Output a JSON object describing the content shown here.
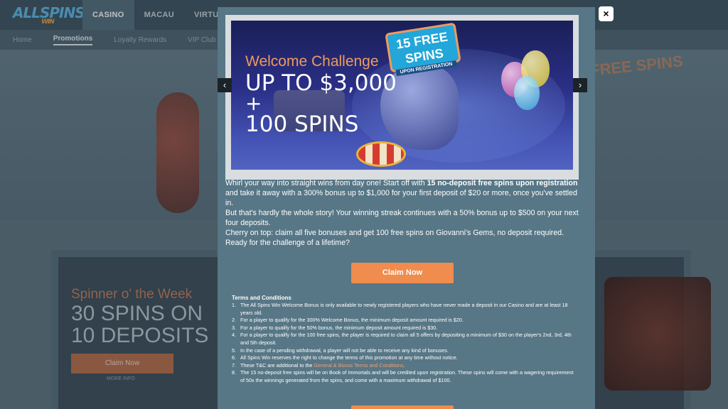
{
  "site": {
    "logo": "ALLSPINS",
    "logo_sub": "WIN",
    "nav": [
      "CASINO",
      "MACAU",
      "VIRTUAL SP"
    ],
    "subnav": [
      "Home",
      "Promotions",
      "Loyalty Rewards",
      "VIP Club"
    ],
    "hero_right_text": "FREE SPINS"
  },
  "background_promo": {
    "title": "Spinner o' the Week",
    "line1": "30 SPINS ON",
    "line2": "10 DEPOSITS",
    "button": "Claim Now",
    "more": "MORE INFO"
  },
  "modal": {
    "close_label": "×",
    "prev_label": "‹",
    "next_label": "›",
    "banner": {
      "title": "Welcome Challenge",
      "line1": "UP TO $3,000",
      "line2": "+",
      "line3": "100 SPINS",
      "badge_top": "15 FREE SPINS",
      "badge_bottom": "UPON REGISTRATION"
    },
    "description": {
      "p1_pre": "Whirl your way into straight wins from day one! Start off with ",
      "p1_bold": "15 no-deposit free spins upon registration",
      "p1_post": " and take it away with a 300% bonus up to $1,000 for your first deposit of $20 or more, once you've settled in.",
      "p2": "But that's hardly the whole story! Your winning streak continues with a 50% bonus up to $500 on your next four deposits.",
      "p3": "Cherry on top: claim all five bonuses and get 100 free spins on Giovanni's Gems, no deposit required.",
      "p4": "Ready for the challenge of a lifetime?"
    },
    "claim_button": "Claim Now",
    "terms": {
      "title": "Terms and Conditions",
      "items": [
        {
          "num": "1.",
          "text": "The All Spins Win Welcome Bonus is only available to newly registered players who have never made a deposit in our Casino and are at least 18 years old."
        },
        {
          "num": "2.",
          "text": "For a player to qualify for the 300% Welcome Bonus, the minimum deposit amount required is $20."
        },
        {
          "num": "3.",
          "text": "For a player to qualify for the 50% bonus, the minimum deposit amount required is $30."
        },
        {
          "num": "4.",
          "text": "For a player to qualify for the 100 free spins, the player is required to claim all 5 offers by depositing a minimum of $30 on the player's 2nd, 3rd, 4th and 5th deposit."
        },
        {
          "num": "5.",
          "text": "In the case of a pending withdrawal, a player will not be able to receive any kind of bonuses."
        },
        {
          "num": "6.",
          "text": "All Spins Win reserves the right to change the terms of this promotion at any time without notice."
        },
        {
          "num": "7.",
          "text_pre": "These T&C are additional to the ",
          "link": "General & Bonus Terms and Conditions",
          "text_post": "."
        },
        {
          "num": "8.",
          "text": "The 15 no-deposit free spins will be on Book of Immortals and will be credited upon registration. These spins will come with a wagering requirement of 50x the winnings generated from the spins, and come with a maximum withdrawal of $100."
        }
      ]
    }
  },
  "colors": {
    "modal_bg": "#577686",
    "accent_orange": "#f08c4e",
    "topbar": "#3f5561"
  }
}
